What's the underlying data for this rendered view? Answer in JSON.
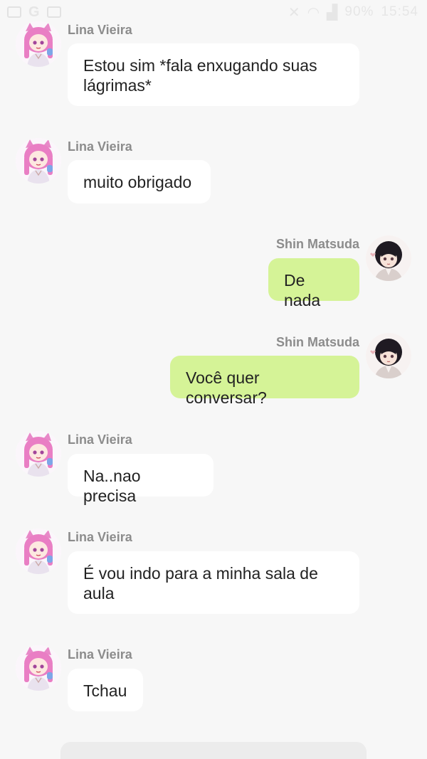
{
  "status_bar": {
    "left_icons": [
      "image-icon",
      "google-icon",
      "media-icon"
    ],
    "right_icons": [
      "mute-icon",
      "wifi-icon",
      "signal-icon"
    ],
    "battery": "90%",
    "time": "15:54"
  },
  "colors": {
    "background": "#f7f7f7",
    "incoming_bubble": "#ffffff",
    "outgoing_bubble": "#d5f397",
    "sender_name": "#8c8c8c"
  },
  "messages": [
    {
      "sender": "Lina Vieira",
      "side": "left",
      "text": "Estou sim *fala enxugando suas lágrimas*"
    },
    {
      "sender": "Lina Vieira",
      "side": "left",
      "text": "muito obrigado"
    },
    {
      "sender": "Shin Matsuda",
      "side": "right",
      "text": "De nada"
    },
    {
      "sender": "Shin Matsuda",
      "side": "right",
      "text": "Você quer conversar?"
    },
    {
      "sender": "Lina Vieira",
      "side": "left",
      "text": "Na..nao precisa"
    },
    {
      "sender": "Lina Vieira",
      "side": "left",
      "text": "É vou indo para a minha sala de aula"
    },
    {
      "sender": "Lina Vieira",
      "side": "left",
      "text": "Tchau"
    }
  ]
}
